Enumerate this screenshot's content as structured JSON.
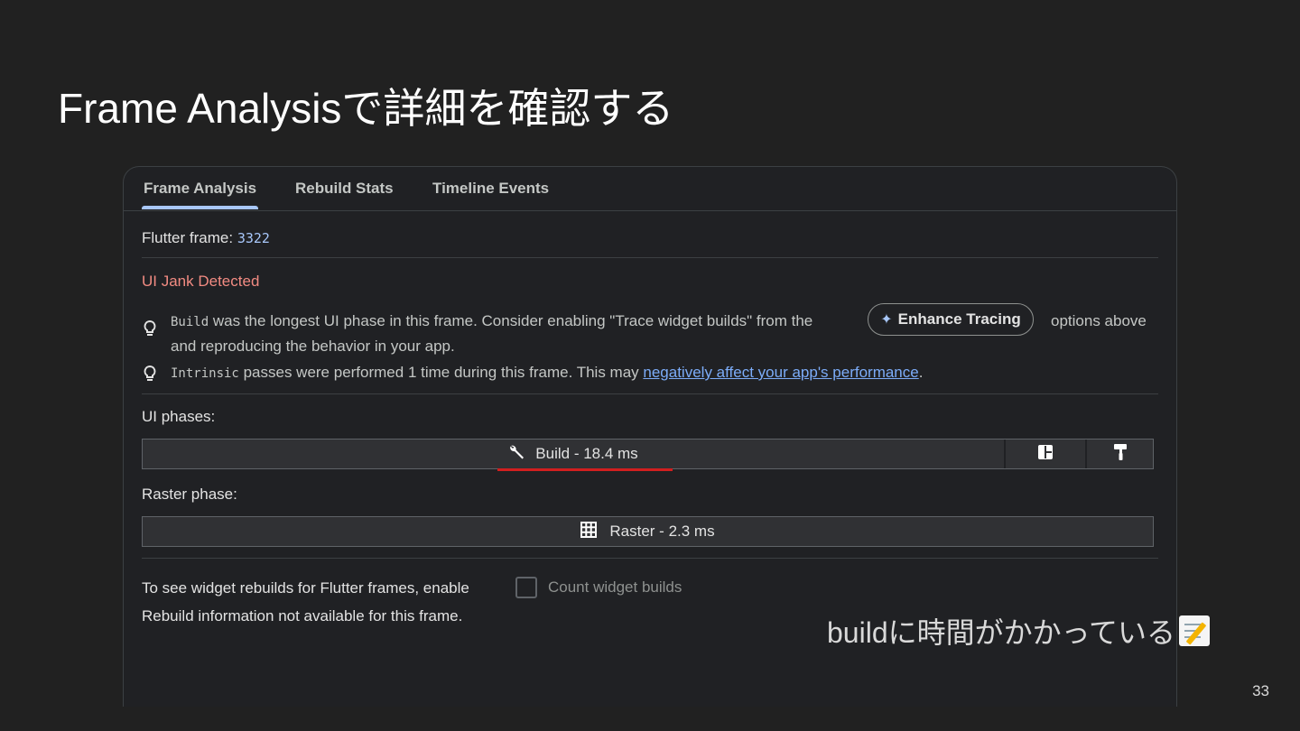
{
  "slide": {
    "title": "Frame Analysisで詳細を確認する",
    "caption": "buildに時間がかかっている",
    "caption_icon": "memo-icon",
    "page_number": "33"
  },
  "tabs": [
    {
      "label": "Frame Analysis",
      "active": true
    },
    {
      "label": "Rebuild Stats",
      "active": false
    },
    {
      "label": "Timeline Events",
      "active": false
    }
  ],
  "frame": {
    "label": "Flutter frame:",
    "number": "3322"
  },
  "jank": {
    "title": "UI Jank Detected",
    "hint1": {
      "code": "Build",
      "text": " was the longest UI phase in this frame. Consider enabling \"Trace widget builds\" from the",
      "button_label": "Enhance Tracing",
      "text_after": "options above",
      "line2": "and reproducing the behavior in your app."
    },
    "hint2": {
      "code": "Intrinsic",
      "text": " passes were performed 1 time during this frame. This may ",
      "link": "negatively affect your app's performance",
      "end": "."
    }
  },
  "ui_phases": {
    "label": "UI phases:",
    "build_label": "Build - 18.4 ms",
    "build_icon": "wrench-icon",
    "layout_icon": "layout-icon",
    "paint_icon": "paint-roller-icon"
  },
  "raster_phase": {
    "label": "Raster phase:",
    "raster_label": "Raster - 2.3 ms",
    "raster_icon": "grid-icon"
  },
  "rebuilds": {
    "text": "To see widget rebuilds for Flutter frames, enable",
    "checkbox_label": "Count widget builds",
    "checkbox_checked": false,
    "not_available": "Rebuild information not available for this frame."
  },
  "colors": {
    "background": "#212121",
    "panel": "#202124",
    "accent": "#a8c7fa",
    "jank": "#f28b82",
    "link": "#7cacf8",
    "highlight_underline": "#d21f1f"
  }
}
